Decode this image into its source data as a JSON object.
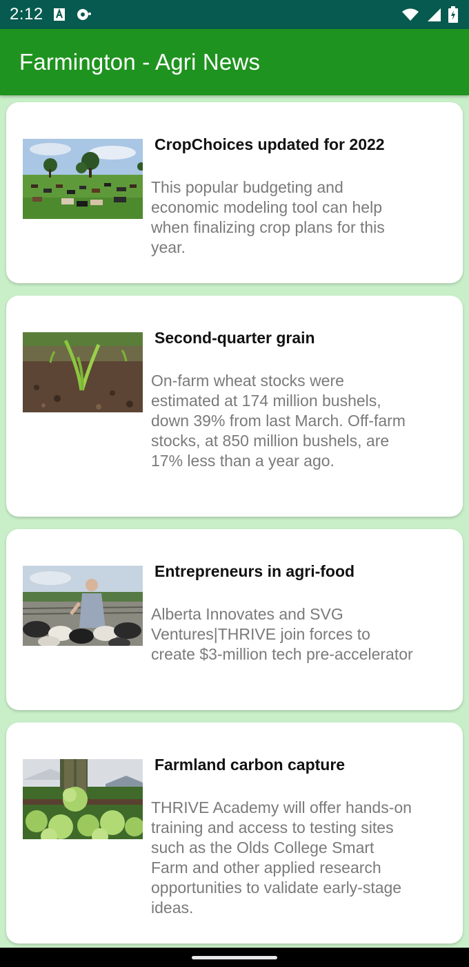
{
  "status_bar": {
    "time": "2:12",
    "icons": [
      "text-a-notification-icon",
      "sync-notification-icon",
      "wifi-icon",
      "cell-signal-icon",
      "battery-charging-icon"
    ]
  },
  "app_bar": {
    "title": "Farmington - Agri News"
  },
  "colors": {
    "app_bar": "#1f931f",
    "status_bar": "#075a4f",
    "background": "#c9efc9"
  },
  "articles": [
    {
      "title": "CropChoices updated for 2022",
      "description": "This popular budgeting and economic modeling tool can help when finalizing crop plans for this year.",
      "image": "cattle-pasture-image"
    },
    {
      "title": "Second-quarter grain",
      "description": "On-farm wheat stocks were estimated at 174 million bushels, down 39% from last March. Off-farm stocks, at 850 million bushels, are 17% less than a year ago.",
      "image": "seedling-soil-image"
    },
    {
      "title": "Entrepreneurs in agri-food",
      "description": "Alberta Innovates and SVG Ventures|THRIVE join forces to create $3-million tech pre-accelerator",
      "image": "farmer-with-sheep-image"
    },
    {
      "title": "Farmland carbon capture",
      "description": "THRIVE Academy will offer hands-on training and access to testing sites such as the Olds College Smart Farm and other applied research opportunities to validate early-stage ideas.",
      "image": "lettuce-harvest-image"
    }
  ]
}
